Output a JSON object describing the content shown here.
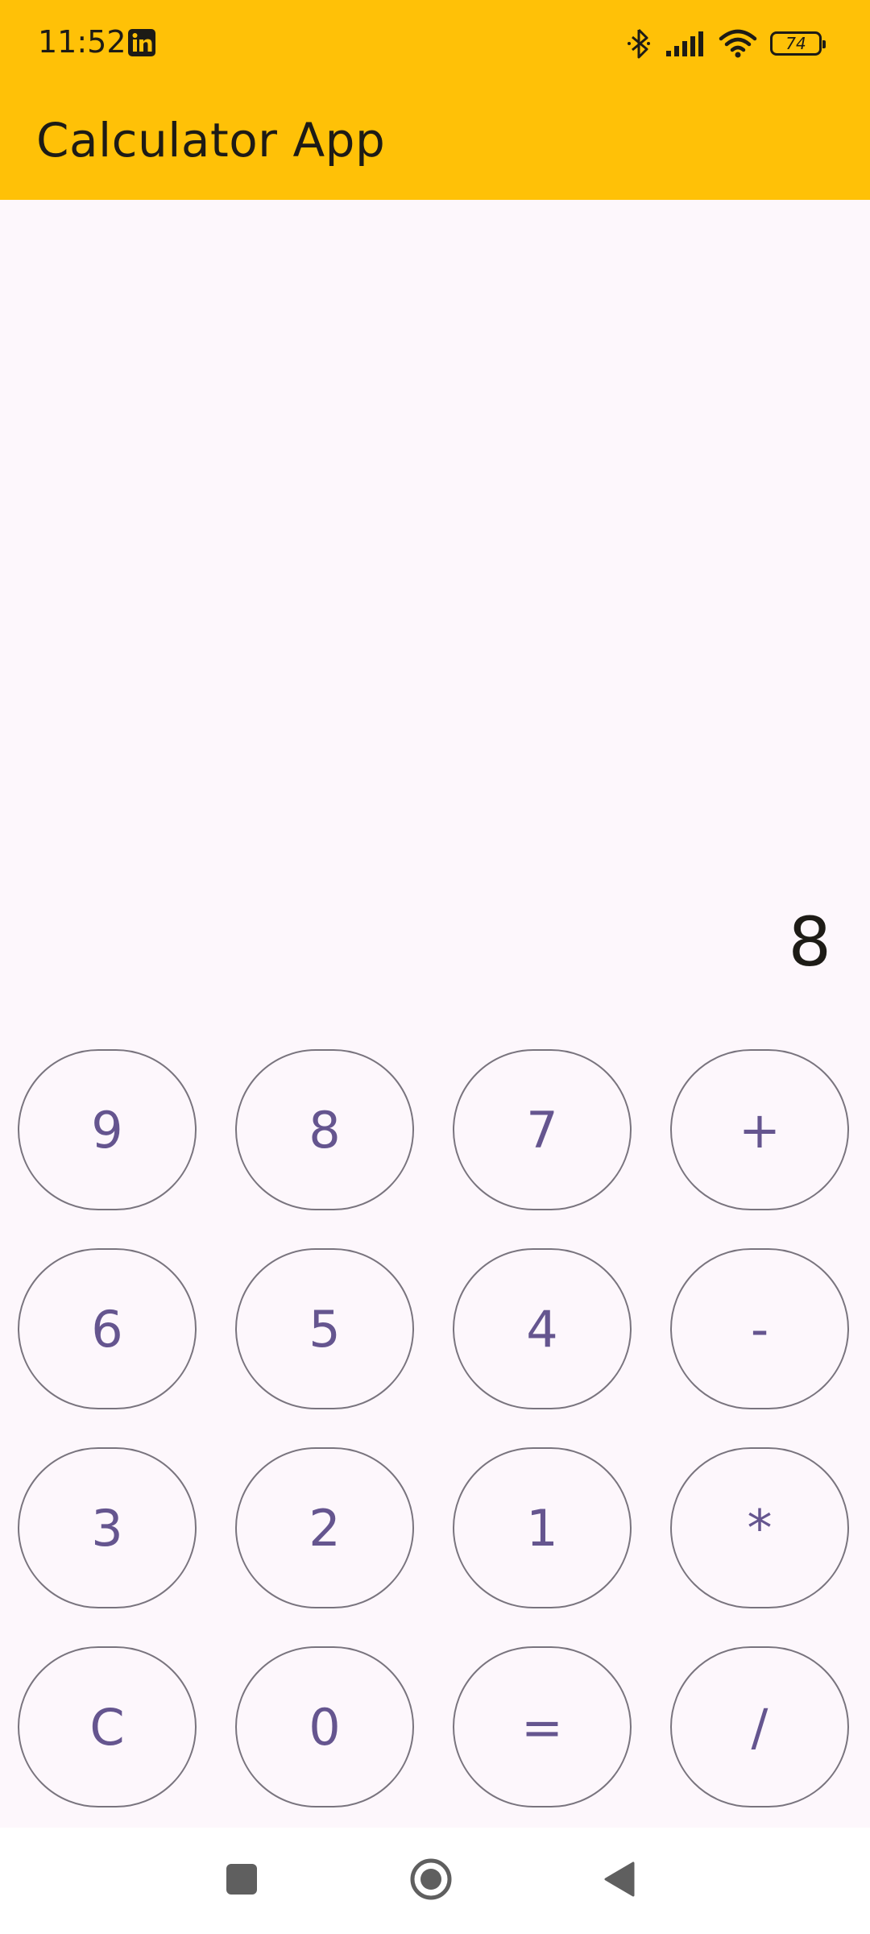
{
  "status_bar": {
    "time": "11:52",
    "battery_level": "74",
    "icons": [
      "linkedin-icon",
      "bluetooth-icon",
      "signal-icon",
      "wifi-icon",
      "battery-icon"
    ]
  },
  "app_bar": {
    "title": "Calculator App"
  },
  "display": {
    "value": "8"
  },
  "keypad": {
    "keys": [
      "9",
      "8",
      "7",
      "+",
      "6",
      "5",
      "4",
      "-",
      "3",
      "2",
      "1",
      "*",
      "C",
      "0",
      "=",
      "/"
    ]
  },
  "nav_bar": {
    "icons": [
      "recents-icon",
      "home-icon",
      "back-icon"
    ]
  },
  "colors": {
    "app_bar": "#ffc107",
    "background": "#fdf7fc",
    "key_text": "#65558f",
    "key_border": "#79747e"
  }
}
